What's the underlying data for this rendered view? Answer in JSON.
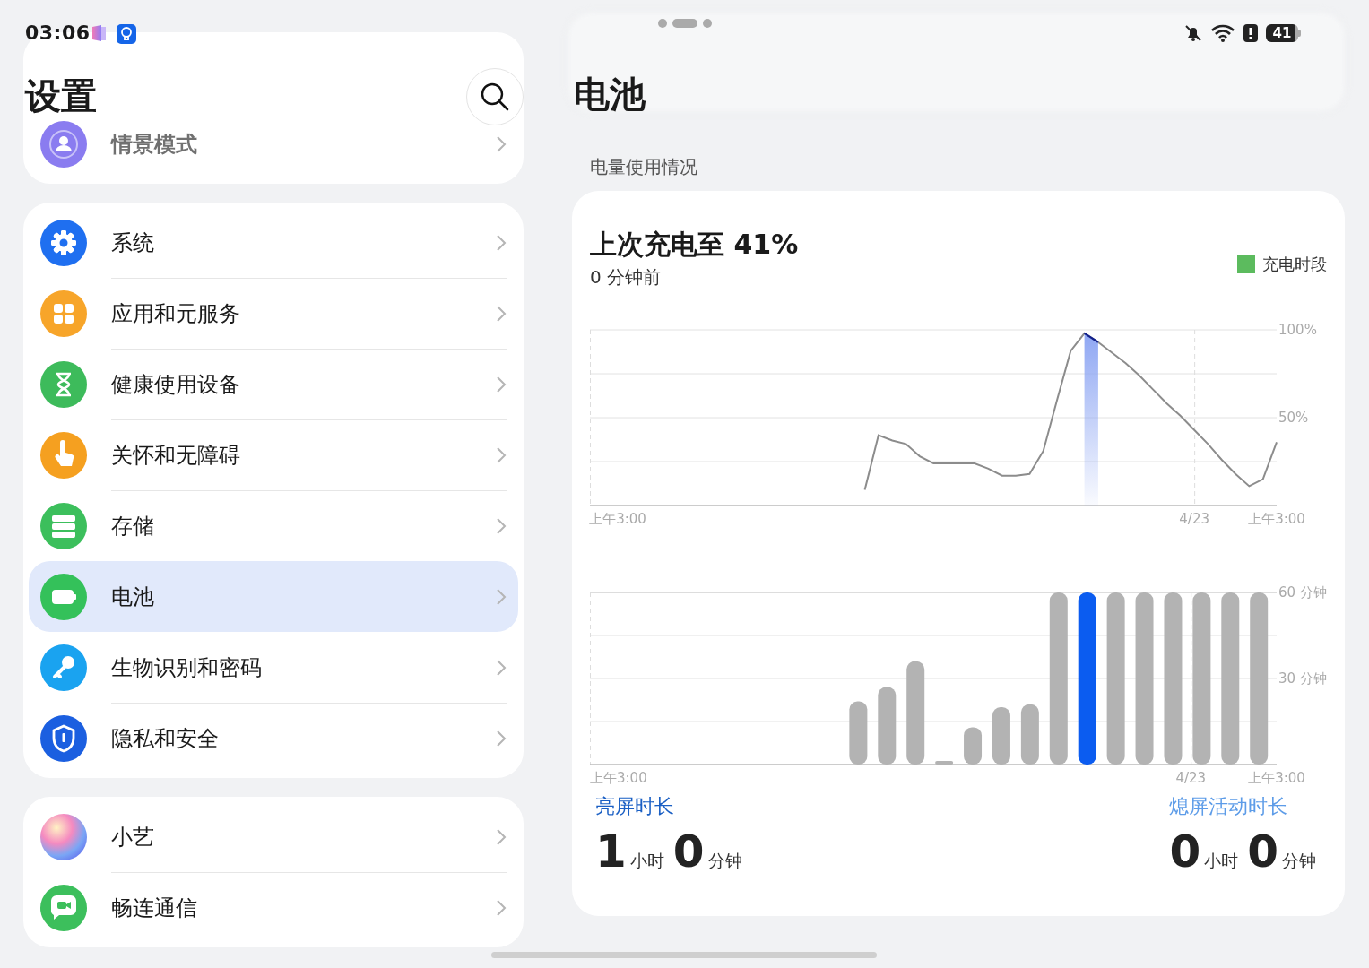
{
  "status_bar": {
    "time": "03:06",
    "battery": "41"
  },
  "sidebar": {
    "title": "设置",
    "groups": [
      {
        "items": [
          {
            "label": "情景模式",
            "kind": "profile",
            "color": "#8a7cf0",
            "selected": false
          }
        ]
      },
      {
        "items": [
          {
            "label": "系统",
            "kind": "gear",
            "color": "#1f6ff0",
            "selected": false
          },
          {
            "label": "应用和元服务",
            "kind": "apps",
            "color": "#f7a52a",
            "selected": false
          },
          {
            "label": "健康使用设备",
            "kind": "hourglass",
            "color": "#3dbb5b",
            "selected": false
          },
          {
            "label": "关怀和无障碍",
            "kind": "hand",
            "color": "#f5a020",
            "selected": false
          },
          {
            "label": "存储",
            "kind": "storage",
            "color": "#3cbf5c",
            "selected": false
          },
          {
            "label": "电池",
            "kind": "battery",
            "color": "#34c15a",
            "selected": true
          },
          {
            "label": "生物识别和密码",
            "kind": "key",
            "color": "#1aa3f0",
            "selected": false
          },
          {
            "label": "隐私和安全",
            "kind": "shield",
            "color": "#1b5fe0",
            "selected": false
          }
        ]
      },
      {
        "items": [
          {
            "label": "小艺",
            "kind": "orb",
            "selected": false
          },
          {
            "label": "畅连通信",
            "kind": "chat",
            "color": "#3cbf5c",
            "selected": false
          }
        ]
      }
    ]
  },
  "detail": {
    "title": "电池",
    "section": "电量使用情况",
    "card": {
      "title": "上次充电至 41%",
      "subtitle": "0 分钟前",
      "legend": "充电时段",
      "level_chart": {
        "chart_data": {
          "type": "line",
          "categories": [
            "上午3:00",
            null,
            null,
            null,
            null,
            null,
            null,
            null,
            null,
            null,
            null,
            null,
            null,
            null,
            null,
            null,
            null,
            null,
            null,
            null,
            null,
            null,
            null,
            null,
            null,
            null,
            null,
            null,
            null,
            null,
            null,
            null,
            null,
            null,
            null,
            null,
            null,
            null,
            null,
            null,
            null,
            null,
            "4/23",
            null,
            null,
            null,
            null,
            null,
            "上午3:00"
          ],
          "series": [
            {
              "color": "#8c8c8c",
              "values": [
                null,
                null,
                null,
                null,
                null,
                null,
                null,
                null,
                null,
                null,
                null,
                null,
                null,
                null,
                null,
                null,
                null,
                null,
                9,
                40,
                37,
                35,
                28,
                24,
                24,
                24,
                24,
                21,
                17,
                17,
                18,
                31,
                60,
                88,
                98,
                93,
                87,
                81,
                74,
                66,
                58,
                51,
                43,
                35,
                26,
                18,
                11,
                15,
                36
              ]
            },
            {
              "type": "area",
              "color": "#8fa7f3",
              "values": [
                null,
                null,
                null,
                null,
                null,
                null,
                null,
                null,
                null,
                null,
                null,
                null,
                null,
                null,
                null,
                null,
                null,
                null,
                null,
                null,
                null,
                null,
                null,
                null,
                null,
                null,
                null,
                null,
                null,
                null,
                null,
                null,
                null,
                null,
                98,
                93,
                null,
                null,
                null,
                null,
                null,
                null,
                null,
                null,
                null,
                null,
                null,
                null,
                null
              ]
            }
          ],
          "ylim": [
            0,
            100
          ],
          "yticks": [
            {
              "value": 100,
              "label": "100%"
            },
            {
              "value": 50,
              "label": "50%"
            }
          ]
        }
      },
      "screen_chart": {
        "chart_data": {
          "type": "bar",
          "categories": [
            "上午3:00",
            null,
            null,
            null,
            null,
            null,
            null,
            null,
            null,
            null,
            null,
            null,
            null,
            null,
            null,
            null,
            null,
            null,
            null,
            null,
            null,
            "4/23",
            null,
            null,
            "上午3:00"
          ],
          "series": [
            {
              "color": "#b3b3b3",
              "values": [
                null,
                null,
                null,
                null,
                null,
                null,
                null,
                null,
                null,
                22,
                27,
                36,
                1,
                13,
                20,
                21,
                60,
                null,
                60,
                60,
                60,
                60,
                60,
                60,
                null
              ]
            },
            {
              "color": "#0b5cf0",
              "values": [
                null,
                null,
                null,
                null,
                null,
                null,
                null,
                null,
                null,
                null,
                null,
                null,
                null,
                null,
                null,
                null,
                null,
                60,
                null,
                null,
                null,
                null,
                null,
                null,
                null
              ]
            }
          ],
          "ylim": [
            0,
            60
          ],
          "yticks": [
            {
              "value": 60,
              "label": "60 分钟"
            },
            {
              "value": 30,
              "label": "30 分钟"
            }
          ]
        }
      },
      "stats": [
        {
          "kind": "screen_on",
          "label": "亮屏时长",
          "hours": "1",
          "hours_unit": "小时",
          "minutes": "0",
          "minutes_unit": "分钟"
        },
        {
          "kind": "screen_off",
          "label": "熄屏活动时长",
          "hours": "0",
          "hours_unit": "小时",
          "minutes": "0",
          "minutes_unit": "分钟"
        }
      ]
    }
  }
}
